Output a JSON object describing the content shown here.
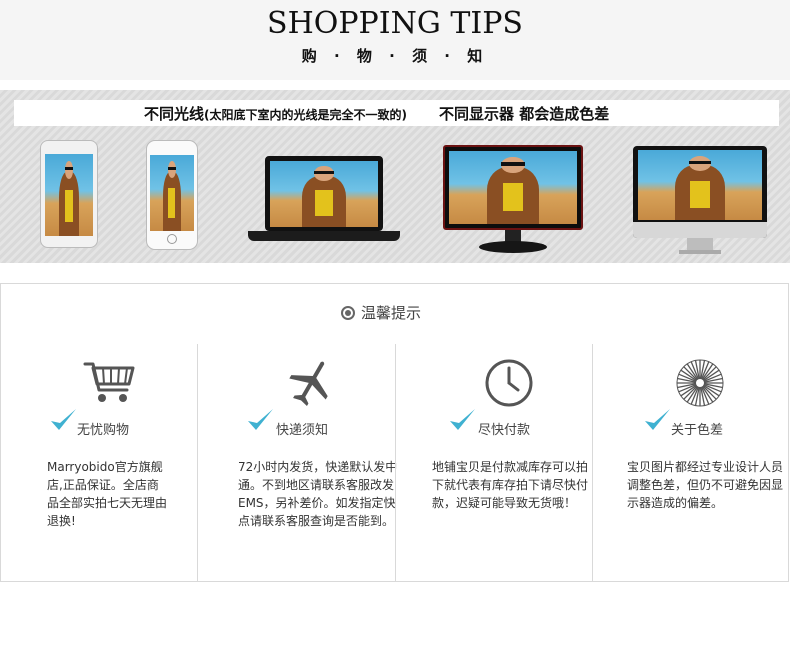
{
  "header": {
    "title": "SHOPPING TIPS",
    "subtitle": "购 · 物 · 须 · 知"
  },
  "banner": {
    "left_main": "不同光线",
    "left_note": "(太阳底下室内的光线是完全不一致的)",
    "right_text": "不同显示器 都会造成色差",
    "devices": [
      "phone",
      "phone",
      "laptop",
      "monitor",
      "imac"
    ]
  },
  "tips": {
    "title": "温馨提示",
    "items": [
      {
        "icon": "shopping-cart-icon",
        "label": "无忧购物",
        "desc": "Marryobido官方旗舰店,正品保证。全店商品全部实拍七天无理由退换!"
      },
      {
        "icon": "airplane-icon",
        "label": "快递须知",
        "desc": "72小时内发货，快递默认发中通。不到地区请联系客服改发EMS，另补差价。如发指定快点请联系客服查询是否能到。"
      },
      {
        "icon": "clock-icon",
        "label": "尽快付款",
        "desc": "地铺宝贝是付款减库存可以拍下就代表有库存拍下请尽快付款，迟疑可能导致无货哦！"
      },
      {
        "icon": "color-wheel-icon",
        "label": "关于色差",
        "desc": "宝贝图片都经过专业设计人员调整色差，但仍不可避免因显示器造成的偏差。"
      }
    ]
  },
  "colors": {
    "check": "#3fb1d1",
    "icon": "#555555",
    "border": "#d9d9d9"
  }
}
